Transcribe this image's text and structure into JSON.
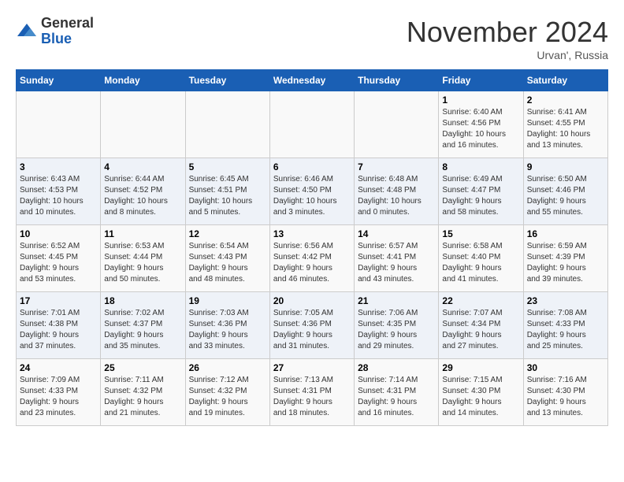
{
  "header": {
    "logo_line1": "General",
    "logo_line2": "Blue",
    "month": "November 2024",
    "location": "Urvan', Russia"
  },
  "weekdays": [
    "Sunday",
    "Monday",
    "Tuesday",
    "Wednesday",
    "Thursday",
    "Friday",
    "Saturday"
  ],
  "weeks": [
    [
      {
        "day": "",
        "info": ""
      },
      {
        "day": "",
        "info": ""
      },
      {
        "day": "",
        "info": ""
      },
      {
        "day": "",
        "info": ""
      },
      {
        "day": "",
        "info": ""
      },
      {
        "day": "1",
        "info": "Sunrise: 6:40 AM\nSunset: 4:56 PM\nDaylight: 10 hours\nand 16 minutes."
      },
      {
        "day": "2",
        "info": "Sunrise: 6:41 AM\nSunset: 4:55 PM\nDaylight: 10 hours\nand 13 minutes."
      }
    ],
    [
      {
        "day": "3",
        "info": "Sunrise: 6:43 AM\nSunset: 4:53 PM\nDaylight: 10 hours\nand 10 minutes."
      },
      {
        "day": "4",
        "info": "Sunrise: 6:44 AM\nSunset: 4:52 PM\nDaylight: 10 hours\nand 8 minutes."
      },
      {
        "day": "5",
        "info": "Sunrise: 6:45 AM\nSunset: 4:51 PM\nDaylight: 10 hours\nand 5 minutes."
      },
      {
        "day": "6",
        "info": "Sunrise: 6:46 AM\nSunset: 4:50 PM\nDaylight: 10 hours\nand 3 minutes."
      },
      {
        "day": "7",
        "info": "Sunrise: 6:48 AM\nSunset: 4:48 PM\nDaylight: 10 hours\nand 0 minutes."
      },
      {
        "day": "8",
        "info": "Sunrise: 6:49 AM\nSunset: 4:47 PM\nDaylight: 9 hours\nand 58 minutes."
      },
      {
        "day": "9",
        "info": "Sunrise: 6:50 AM\nSunset: 4:46 PM\nDaylight: 9 hours\nand 55 minutes."
      }
    ],
    [
      {
        "day": "10",
        "info": "Sunrise: 6:52 AM\nSunset: 4:45 PM\nDaylight: 9 hours\nand 53 minutes."
      },
      {
        "day": "11",
        "info": "Sunrise: 6:53 AM\nSunset: 4:44 PM\nDaylight: 9 hours\nand 50 minutes."
      },
      {
        "day": "12",
        "info": "Sunrise: 6:54 AM\nSunset: 4:43 PM\nDaylight: 9 hours\nand 48 minutes."
      },
      {
        "day": "13",
        "info": "Sunrise: 6:56 AM\nSunset: 4:42 PM\nDaylight: 9 hours\nand 46 minutes."
      },
      {
        "day": "14",
        "info": "Sunrise: 6:57 AM\nSunset: 4:41 PM\nDaylight: 9 hours\nand 43 minutes."
      },
      {
        "day": "15",
        "info": "Sunrise: 6:58 AM\nSunset: 4:40 PM\nDaylight: 9 hours\nand 41 minutes."
      },
      {
        "day": "16",
        "info": "Sunrise: 6:59 AM\nSunset: 4:39 PM\nDaylight: 9 hours\nand 39 minutes."
      }
    ],
    [
      {
        "day": "17",
        "info": "Sunrise: 7:01 AM\nSunset: 4:38 PM\nDaylight: 9 hours\nand 37 minutes."
      },
      {
        "day": "18",
        "info": "Sunrise: 7:02 AM\nSunset: 4:37 PM\nDaylight: 9 hours\nand 35 minutes."
      },
      {
        "day": "19",
        "info": "Sunrise: 7:03 AM\nSunset: 4:36 PM\nDaylight: 9 hours\nand 33 minutes."
      },
      {
        "day": "20",
        "info": "Sunrise: 7:05 AM\nSunset: 4:36 PM\nDaylight: 9 hours\nand 31 minutes."
      },
      {
        "day": "21",
        "info": "Sunrise: 7:06 AM\nSunset: 4:35 PM\nDaylight: 9 hours\nand 29 minutes."
      },
      {
        "day": "22",
        "info": "Sunrise: 7:07 AM\nSunset: 4:34 PM\nDaylight: 9 hours\nand 27 minutes."
      },
      {
        "day": "23",
        "info": "Sunrise: 7:08 AM\nSunset: 4:33 PM\nDaylight: 9 hours\nand 25 minutes."
      }
    ],
    [
      {
        "day": "24",
        "info": "Sunrise: 7:09 AM\nSunset: 4:33 PM\nDaylight: 9 hours\nand 23 minutes."
      },
      {
        "day": "25",
        "info": "Sunrise: 7:11 AM\nSunset: 4:32 PM\nDaylight: 9 hours\nand 21 minutes."
      },
      {
        "day": "26",
        "info": "Sunrise: 7:12 AM\nSunset: 4:32 PM\nDaylight: 9 hours\nand 19 minutes."
      },
      {
        "day": "27",
        "info": "Sunrise: 7:13 AM\nSunset: 4:31 PM\nDaylight: 9 hours\nand 18 minutes."
      },
      {
        "day": "28",
        "info": "Sunrise: 7:14 AM\nSunset: 4:31 PM\nDaylight: 9 hours\nand 16 minutes."
      },
      {
        "day": "29",
        "info": "Sunrise: 7:15 AM\nSunset: 4:30 PM\nDaylight: 9 hours\nand 14 minutes."
      },
      {
        "day": "30",
        "info": "Sunrise: 7:16 AM\nSunset: 4:30 PM\nDaylight: 9 hours\nand 13 minutes."
      }
    ]
  ]
}
